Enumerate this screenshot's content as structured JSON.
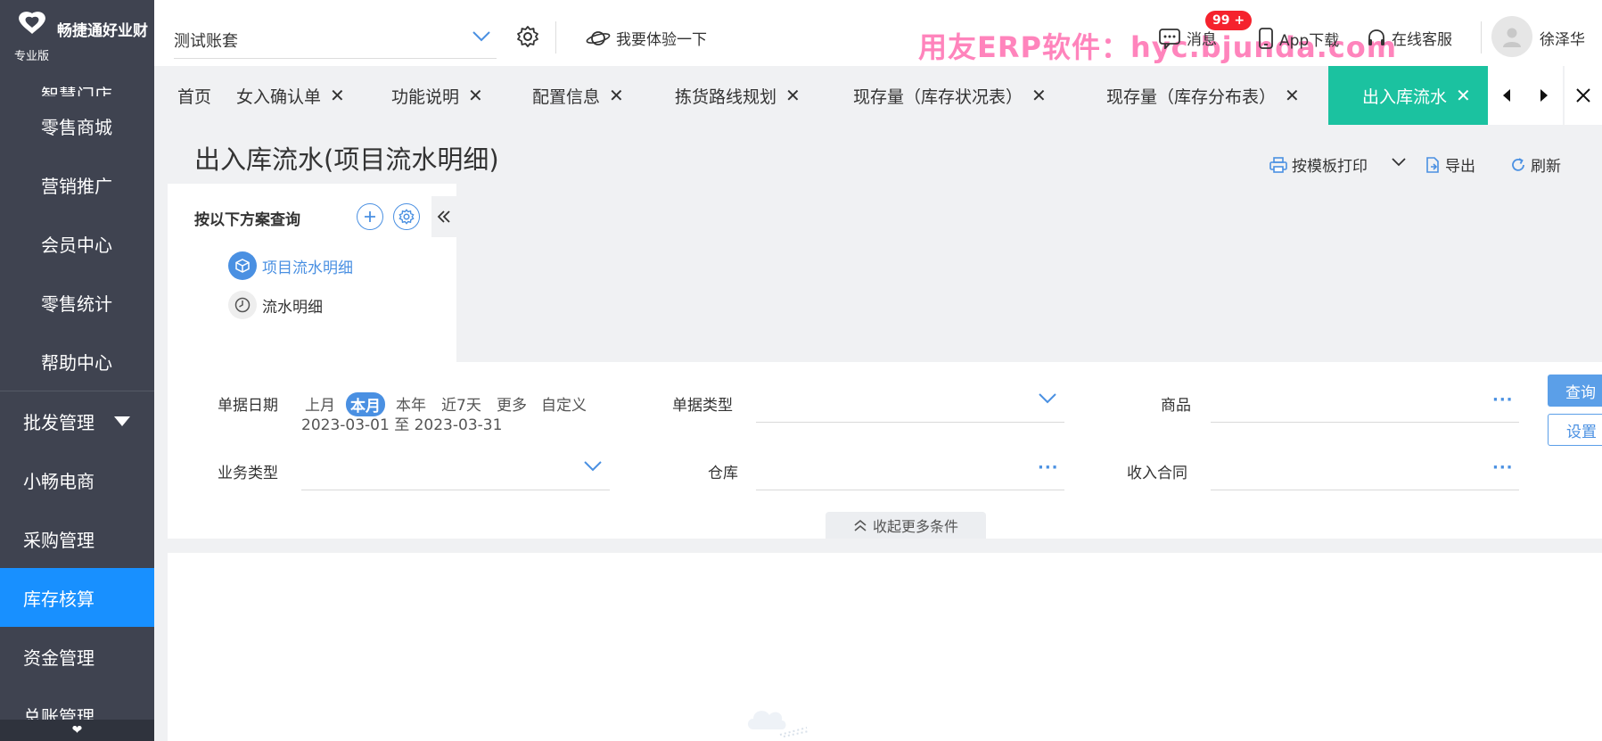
{
  "sidebar": {
    "logo_text": "畅捷通好业财",
    "edition": "专业版",
    "partial_item": "智慧门店",
    "sub_items": [
      "零售商城",
      "营销推广",
      "会员中心",
      "零售统计",
      "帮助中心"
    ],
    "groups": [
      "批发管理",
      "小畅电商",
      "采购管理",
      "库存核算",
      "资金管理",
      "总账管理"
    ],
    "active_group": "库存核算",
    "footer_glyph": "❤"
  },
  "topbar": {
    "account": "测试账套",
    "try_label": "我要体验一下",
    "watermark": "用友ERP软件：hyc.bjunda.com",
    "messages_label": "消息",
    "messages_badge": "99 +",
    "app_download": "App下载",
    "online_service": "在线客服",
    "username": "徐泽华"
  },
  "tabs": [
    {
      "label": "首页",
      "closable": false
    },
    {
      "label": "女入确认单",
      "closable": true
    },
    {
      "label": "功能说明",
      "closable": true
    },
    {
      "label": "配置信息",
      "closable": true
    },
    {
      "label": "拣货路线规划",
      "closable": true
    },
    {
      "label": "现存量（库存状况表）",
      "closable": true
    },
    {
      "label": "现存量（库存分布表）",
      "closable": true
    },
    {
      "label": "出入库流水",
      "closable": true,
      "active": true
    }
  ],
  "page": {
    "title": "出入库流水(项目流水明细)",
    "print_label": "按模板打印",
    "export_label": "导出",
    "refresh_label": "刷新"
  },
  "scheme": {
    "title": "按以下方案查询",
    "items": [
      {
        "label": "项目流水明细",
        "selected": true,
        "icon": "cube-icon"
      },
      {
        "label": "流水明细",
        "selected": false,
        "icon": "clock-icon"
      }
    ]
  },
  "filters": {
    "date_label": "单据日期",
    "date_chips": [
      "上月",
      "本月",
      "本年",
      "近7天",
      "更多",
      "自定义"
    ],
    "date_selected": "本月",
    "date_range": "2023-03-01 至 2023-03-31",
    "doc_type_label": "单据类型",
    "goods_label": "商品",
    "biz_type_label": "业务类型",
    "warehouse_label": "仓库",
    "contract_label": "收入合同",
    "query_btn": "查询",
    "settings_btn": "设置",
    "collapse_more": "收起更多条件"
  },
  "colors": {
    "sidebar_bg": "#3f4350",
    "accent_blue": "#1890ff",
    "tab_active": "#1bc2a0",
    "badge_red": "#f5222d"
  }
}
